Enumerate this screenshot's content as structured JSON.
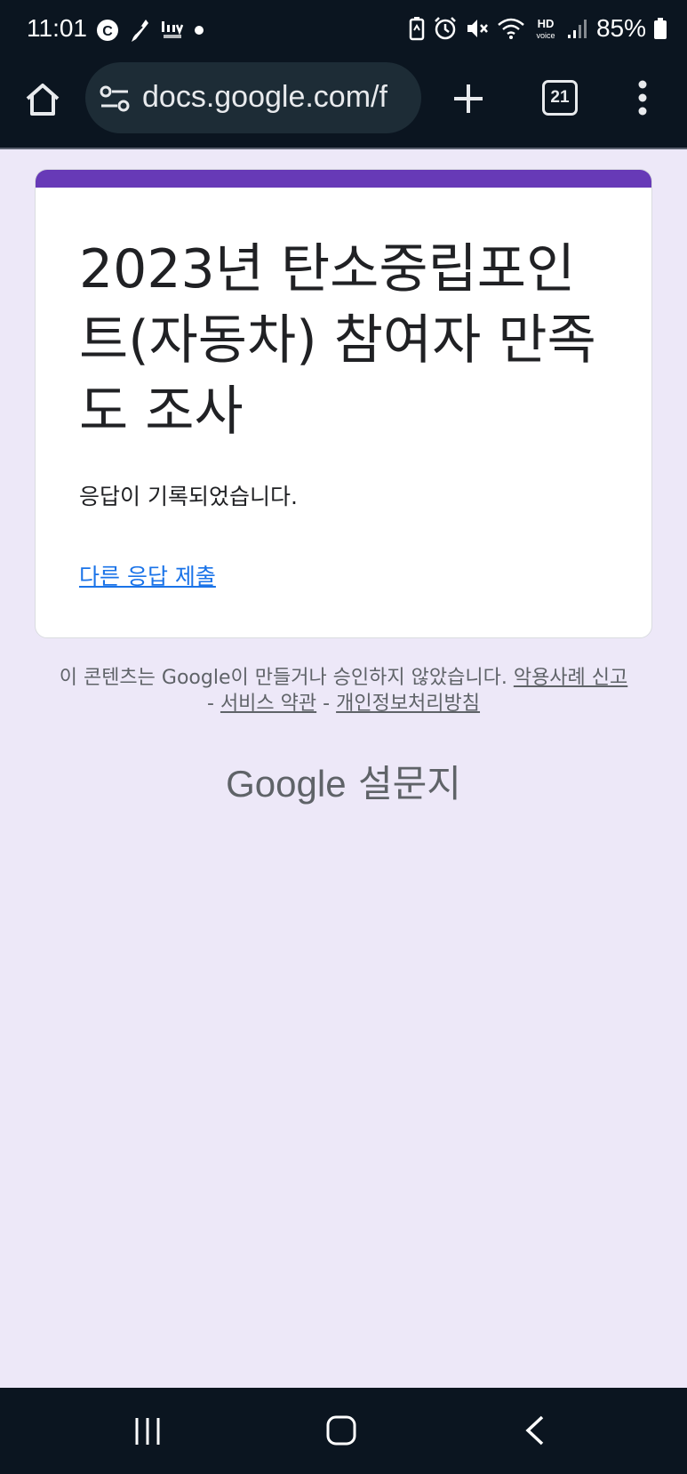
{
  "status_bar": {
    "time": "11:01",
    "battery": "85%",
    "notification_icons": [
      "c-icon",
      "feather-icon",
      "liiv-next-icon",
      "dot-icon"
    ],
    "system_icons": [
      "battery-saver-icon",
      "alarm-icon",
      "mute-icon",
      "wifi-icon",
      "hd-voice-icon",
      "signal-icon",
      "battery-icon"
    ]
  },
  "browser": {
    "url": "docs.google.com/f",
    "tab_count": "21"
  },
  "form": {
    "title": "2023년 탄소중립포인트(자동차) 참여자 만족도 조사",
    "message": "응답이 기록되었습니다.",
    "submit_another": "다른 응답 제출",
    "accent_color": "#673ab7"
  },
  "footer": {
    "disclaimer": "이 콘텐츠는 Google이 만들거나 승인하지 않았습니다.",
    "report_abuse": "악용사례 신고",
    "separator": "-",
    "terms": "서비스 약관",
    "privacy": "개인정보처리방침",
    "brand_google": "Google",
    "brand_forms": "설문지"
  }
}
